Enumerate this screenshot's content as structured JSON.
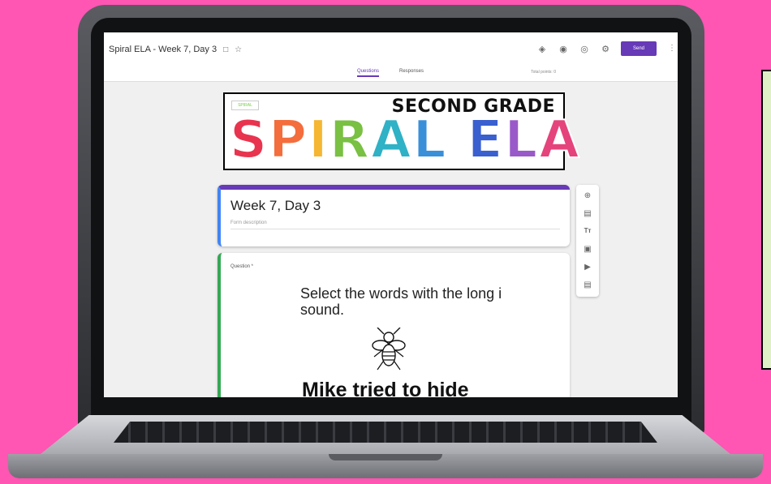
{
  "topbar": {
    "doc_title": "Spiral ELA - Week 7, Day 3",
    "send_label": "Send"
  },
  "tabs": [
    {
      "label": "Questions",
      "active": true
    },
    {
      "label": "Responses",
      "active": false
    }
  ],
  "points_label": "Total points: 0",
  "banner": {
    "subtitle": "SECOND GRADE",
    "letters": [
      {
        "char": "S",
        "color": "#e8344e"
      },
      {
        "char": "P",
        "color": "#f46d3c"
      },
      {
        "char": "I",
        "color": "#f5b632"
      },
      {
        "char": "R",
        "color": "#79c043"
      },
      {
        "char": "A",
        "color": "#2fb1c6"
      },
      {
        "char": "L",
        "color": "#3a8fd9"
      },
      {
        "char": " ",
        "color": "#ffffff"
      },
      {
        "char": "E",
        "color": "#3a5fcf"
      },
      {
        "char": "L",
        "color": "#9a59c8"
      },
      {
        "char": "A",
        "color": "#e5437b"
      }
    ]
  },
  "form": {
    "title": "Week 7, Day 3",
    "description_placeholder": "Form description"
  },
  "question": {
    "label": "Question *",
    "prompt": "Select the words with the long i sound.",
    "sentence": "Mike tried to hide"
  },
  "colors": {
    "background": "#ff55b3",
    "accent": "#673ab7",
    "side_panel": "#dff0c7"
  }
}
